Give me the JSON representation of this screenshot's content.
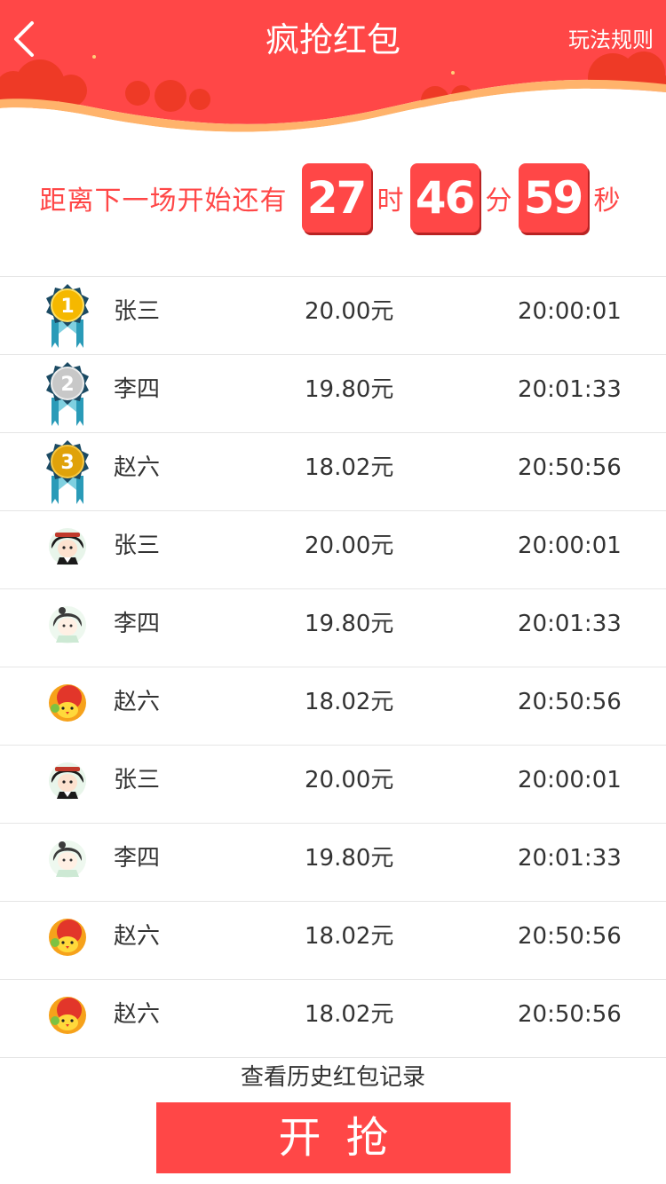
{
  "header": {
    "title": "疯抢红包",
    "rules_label": "玩法规则",
    "back_icon": "chevron-left-icon"
  },
  "countdown": {
    "label": "距离下一场开始还有",
    "hours": "27",
    "hours_unit": "时",
    "minutes": "46",
    "minutes_unit": "分",
    "seconds": "59",
    "seconds_unit": "秒"
  },
  "records": [
    {
      "rank_icon": "gold-medal-1-icon",
      "name": "张三",
      "amount": "20.00元",
      "time": "20:00:01"
    },
    {
      "rank_icon": "silver-medal-2-icon",
      "name": "李四",
      "amount": "19.80元",
      "time": "20:01:33"
    },
    {
      "rank_icon": "bronze-medal-3-icon",
      "name": "赵六",
      "amount": "18.02元",
      "time": "20:50:56"
    },
    {
      "rank_icon": "avatar-girl-black-hair-icon",
      "name": "张三",
      "amount": "20.00元",
      "time": "20:00:01"
    },
    {
      "rank_icon": "avatar-girl-pale-icon",
      "name": "李四",
      "amount": "19.80元",
      "time": "20:01:33"
    },
    {
      "rank_icon": "avatar-chick-icon",
      "name": "赵六",
      "amount": "18.02元",
      "time": "20:50:56"
    },
    {
      "rank_icon": "avatar-girl-black-hair-icon",
      "name": "张三",
      "amount": "20.00元",
      "time": "20:00:01"
    },
    {
      "rank_icon": "avatar-girl-pale-icon",
      "name": "李四",
      "amount": "19.80元",
      "time": "20:01:33"
    },
    {
      "rank_icon": "avatar-chick-icon",
      "name": "赵六",
      "amount": "18.02元",
      "time": "20:50:56"
    },
    {
      "rank_icon": "avatar-chick-icon",
      "name": "赵六",
      "amount": "18.02元",
      "time": "20:50:56"
    }
  ],
  "footer": {
    "history_label": "查看历史红包记录",
    "grab_label": "开抢"
  },
  "colors": {
    "accent_red": "#ff4747",
    "gold": "#f5b800",
    "silver": "#c8c8c8",
    "bronze": "#e0a20a",
    "ribbon": "#2a9bb8"
  }
}
